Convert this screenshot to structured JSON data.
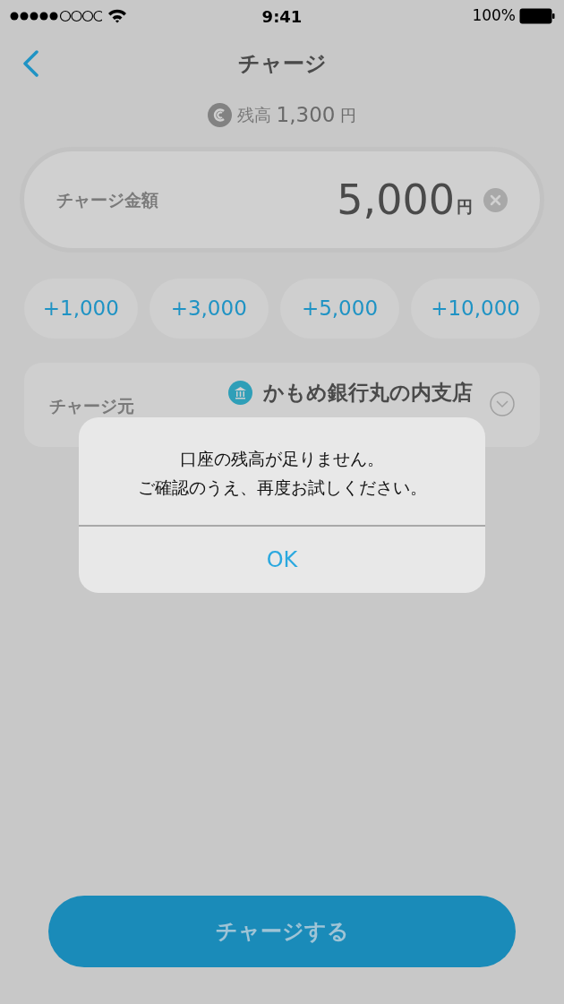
{
  "status_bar": {
    "time": "9:41",
    "battery": "100%"
  },
  "nav": {
    "title": "チャージ"
  },
  "balance": {
    "label": "残高",
    "amount": "1,300",
    "unit": "円"
  },
  "amount_field": {
    "label": "チャージ金額",
    "value": "5,000",
    "unit": "円"
  },
  "quick_add": [
    "+1,000",
    "+3,000",
    "+5,000",
    "+10,000"
  ],
  "source": {
    "label": "チャージ元",
    "bank": "かもめ銀行丸の内支店"
  },
  "alert": {
    "lines": [
      "口座の残高が足りません。",
      "ご確認のうえ、再度お試しください。"
    ],
    "button": "OK"
  },
  "charge_button": "チャージする"
}
